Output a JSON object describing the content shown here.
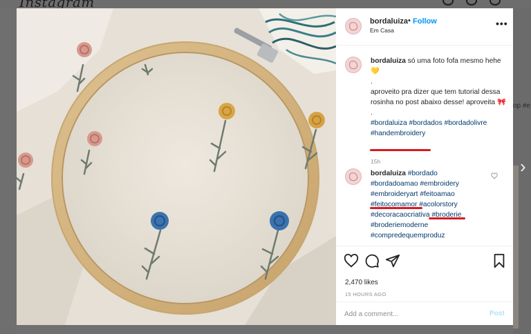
{
  "app": {
    "logo": "Instagram"
  },
  "background": {
    "side_text": "op #e",
    "next_arrow": "›"
  },
  "header": {
    "username": "bordaluiza",
    "separator": "•",
    "follow_label": "Follow",
    "location": "Em Casa",
    "more": "•••"
  },
  "caption": {
    "username": "bordaluiza",
    "line1": "só uma foto fofa mesmo hehe",
    "emoji": "💛",
    "dot1": ".",
    "line2": "aproveito pra dizer que tem tutorial dessa rosinha no post abaixo desse! aproveita",
    "emoji2": "🎀",
    "dot2": ".",
    "hashtags": [
      "#bordaluiza",
      "#bordados",
      "#bordadolivre",
      "#handembroidery"
    ],
    "time": "15h"
  },
  "comment": {
    "username": "bordaluiza",
    "hashtags": [
      "#bordado",
      "#bordadoamao",
      "#embroidery",
      "#embroideryart",
      "#feitoamao",
      "#feitocomamor",
      "#acolorstory",
      "#decoracaocriativa",
      "#broderie",
      "#broderiemoderne",
      "#compredequemproduz"
    ]
  },
  "actions": {
    "icons": [
      "heart-icon",
      "comment-icon",
      "share-icon",
      "bookmark-icon"
    ],
    "likes": "2,470 likes",
    "posted": "15 HOURS AGO"
  },
  "add_comment": {
    "placeholder": "Add a comment...",
    "post_label": "Post"
  },
  "colors": {
    "link": "#0095f6",
    "hashtag": "#00376b",
    "underline": "#d71920",
    "post_disabled": "#b2dffc"
  }
}
